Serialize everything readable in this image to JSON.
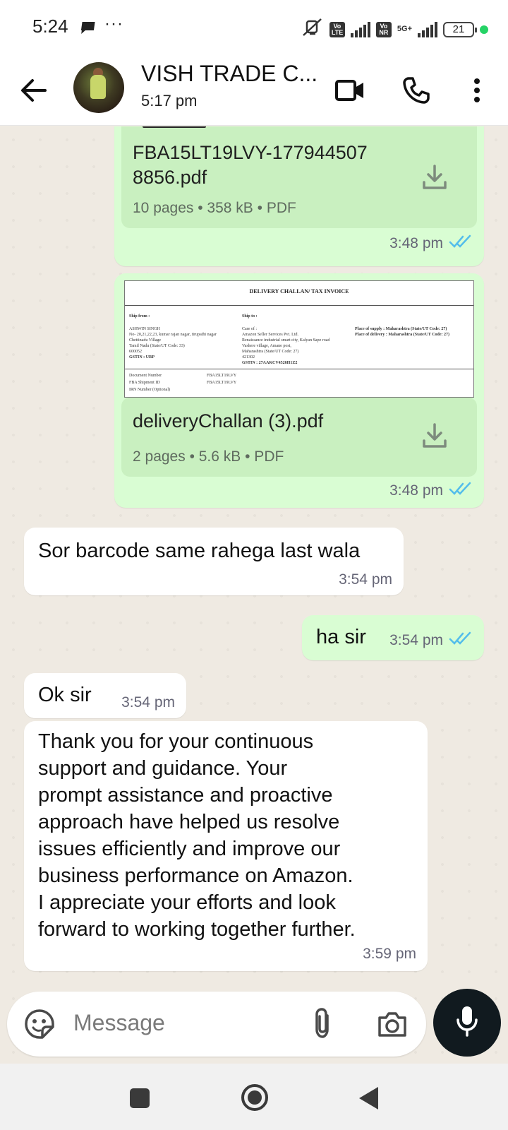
{
  "status_bar": {
    "time": "5:24",
    "more": "···",
    "tag_volte1": "Vo LTE",
    "tag_vonr": "Vo NR",
    "net": "5G+",
    "battery": "21"
  },
  "header": {
    "contact_name": "VISH TRADE C...",
    "contact_status": "5:17 pm"
  },
  "messages": [
    {
      "direction": "out",
      "type": "document",
      "file_name_line1": "FBA15LT19LVY-177944507",
      "file_name_line2": "8856.pdf",
      "meta": "10 pages • 358 kB • PDF",
      "time": "3:48 pm",
      "status": "read"
    },
    {
      "direction": "out",
      "type": "document",
      "preview": {
        "title": "DELIVERY CHALLAN/ TAX INVOICE",
        "ship_from_label": "Ship from :",
        "ship_from_lines": [
          "ASHWIN SINGH",
          "No- 20,21,22,23, kumar rajan nagar, tirupathi nagar",
          "Chettinadu Village",
          "Tamil Nadu (State/UT Code: 33)",
          "600052",
          "GSTIN : URP"
        ],
        "ship_to_label": "Ship to :",
        "ship_to_lines": [
          "Care of :",
          "Amazon Seller Services Pvt. Ltd.",
          "Renaissance industrial smart city, Kalyan Sape road",
          "Vashere village, Amane post,",
          "Maharashtra (State/UT Code: 27)",
          "421302",
          "GSTIN : 27AAKCV4526H1Z2"
        ],
        "supply_lines": [
          "Place of supply : Maharashtra (State/UT Code: 27)",
          "Place of delivery : Maharashtra (State/UT Code: 27)"
        ],
        "doc_lines": [
          {
            "label": "Document Number",
            "value": "FBA15LT19LVY"
          },
          {
            "label": "FBA Shipment ID",
            "value": "FBA15LT19LVY"
          },
          {
            "label": "IRN Number (Optional)",
            "value": ""
          }
        ]
      },
      "file_name": "deliveryChallan (3).pdf",
      "meta": "2 pages • 5.6 kB • PDF",
      "time": "3:48 pm",
      "status": "read"
    },
    {
      "direction": "in",
      "type": "text",
      "text": "Sor barcode same rahega last wala",
      "time": "3:54 pm"
    },
    {
      "direction": "out",
      "type": "text",
      "text": "ha sir",
      "time": "3:54 pm",
      "status": "read"
    },
    {
      "direction": "in",
      "type": "text",
      "text": "Ok sir",
      "time": "3:54 pm"
    },
    {
      "direction": "in",
      "type": "text",
      "lines": [
        "Thank you for your continuous",
        "support and guidance. Your",
        "prompt assistance and proactive",
        "approach have helped us resolve",
        "issues efficiently and improve our",
        "business performance on Amazon.",
        "I appreciate your efforts and look",
        "forward to working together further."
      ],
      "time": "3:59 pm"
    }
  ],
  "composer": {
    "placeholder": "Message"
  },
  "colors": {
    "outgoing_bubble": "#d9fdd3",
    "incoming_bubble": "#ffffff",
    "read_ticks": "#53bdeb",
    "chat_background": "#efeae2",
    "mic_button": "#111a1f"
  },
  "icons": {
    "header": [
      "back-arrow-icon",
      "video-call-icon",
      "voice-call-icon",
      "more-options-icon"
    ],
    "composer": [
      "sticker-icon",
      "attach-icon",
      "camera-icon",
      "mic-icon"
    ],
    "nav": [
      "recents-square-icon",
      "home-circle-icon",
      "back-triangle-icon"
    ]
  }
}
